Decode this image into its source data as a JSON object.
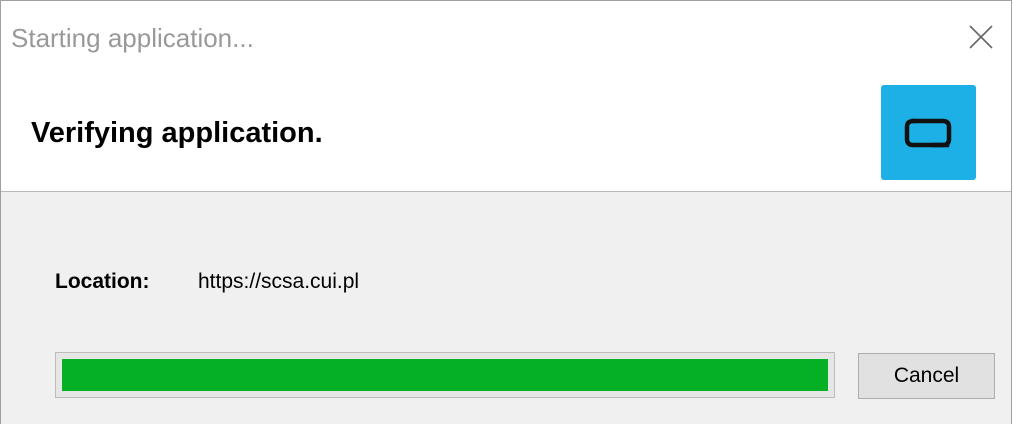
{
  "window": {
    "title": "Starting application...",
    "close_icon": "close-icon"
  },
  "header": {
    "title": "Verifying application.",
    "app_icon": "app-logo-icon"
  },
  "body": {
    "location_label": "Location:",
    "location_value": "https://scsa.cui.pl",
    "progress_percent": 100,
    "cancel_label": "Cancel"
  },
  "colors": {
    "progress_fill": "#06b025",
    "app_icon_bg": "#1cb0e6",
    "body_bg": "#f0f0f0"
  }
}
